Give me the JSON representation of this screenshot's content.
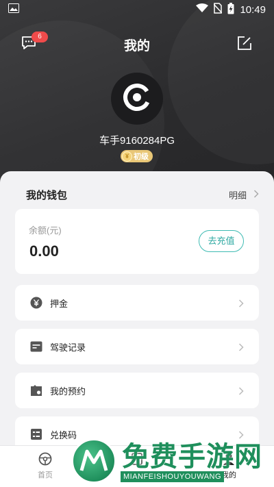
{
  "status_bar": {
    "time": "10:49"
  },
  "header": {
    "title": "我的",
    "message_badge": "6"
  },
  "profile": {
    "username": "车手9160284PG",
    "level": "初级"
  },
  "wallet": {
    "title": "我的钱包",
    "detail_label": "明细",
    "balance_label": "余额(元)",
    "balance_value": "0.00",
    "recharge_label": "去充值"
  },
  "menu": [
    {
      "label": "押金",
      "icon": "yen-icon"
    },
    {
      "label": "驾驶记录",
      "icon": "record-icon"
    },
    {
      "label": "我的预约",
      "icon": "calendar-icon"
    },
    {
      "label": "兑换码",
      "icon": "voucher-icon"
    }
  ],
  "tabbar": [
    {
      "label": "首页",
      "icon": "steering-wheel-icon",
      "active": false
    },
    {
      "label": "订单",
      "icon": "order-icon",
      "active": false
    },
    {
      "label": "我的",
      "icon": "user-icon",
      "active": true
    }
  ],
  "watermark": {
    "title": "免费手游网",
    "subtitle": "MIANFEISHOUYOUWANG"
  },
  "colors": {
    "accent": "#3dbab2",
    "badge": "#f04b4b",
    "level": "#e9c777",
    "header_bg": "#2b2b2d"
  }
}
